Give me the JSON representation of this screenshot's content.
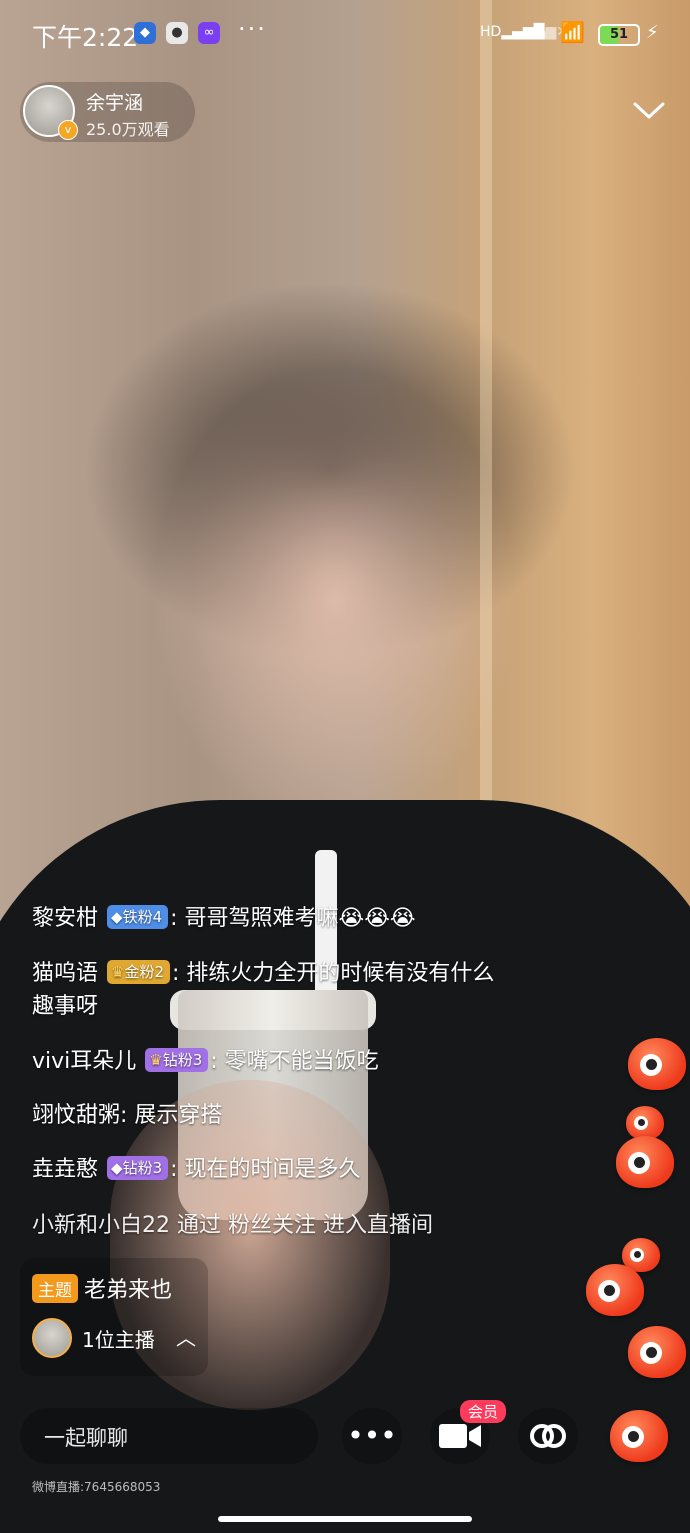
{
  "status_bar": {
    "time": "下午2:22",
    "dots": "···",
    "signal_label": "HD",
    "battery": "51",
    "battery_level": 0.51
  },
  "host": {
    "name": "余宇涵",
    "viewers": "25.0万观看"
  },
  "chat_messages": [
    {
      "user": "黎安柑",
      "badge": "铁粉4",
      "text": "哥哥驾照难考嘛😭😭😭"
    },
    {
      "user": "猫呜语",
      "badge": "金粉2",
      "text": "排练火力全开的时候有没有什么",
      "text_line2": "趣事呀"
    },
    {
      "user": "vivi耳朵儿",
      "badge": "钻粉3",
      "text": "零嘴不能当饭吃"
    },
    {
      "user": "翊忟甜粥",
      "text": "展示穿搭"
    },
    {
      "user": "垚垚憨",
      "badge": "钻粉3",
      "text": "现在的时间是多久"
    }
  ],
  "system_message": {
    "user": "小新和小白22",
    "prefix": "通过",
    "highlight": "粉丝关注",
    "suffix": "进入直播间"
  },
  "topic": {
    "tag": "主题",
    "title": "老弟来也",
    "hosts": "1位主播"
  },
  "bottom_bar": {
    "chat_placeholder": "一起聊聊",
    "vip_label": "会员"
  },
  "footer": "微博直播:7645668053",
  "colors": {
    "iron_badge": "#4f8ee8",
    "gold_badge": "#e0a830",
    "diamond_badge": "#a170e6",
    "topic_tag": "#f39a1c",
    "vip_tag": "#ff3b5c"
  }
}
